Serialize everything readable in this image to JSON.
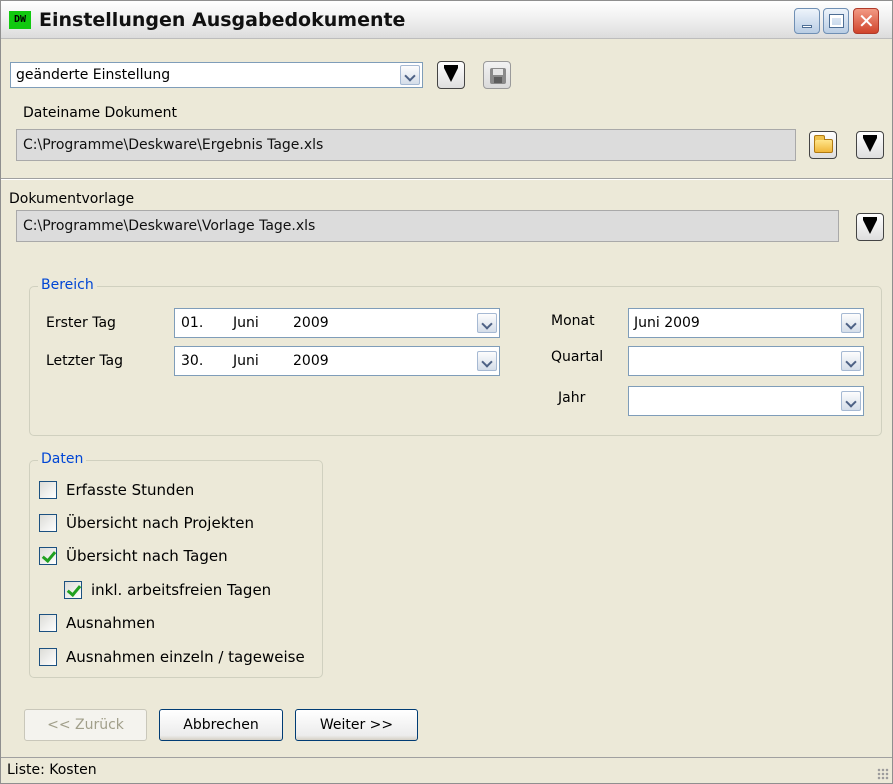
{
  "window": {
    "app_icon_text": "DW",
    "title": "Einstellungen Ausgabedokumente",
    "close_glyph": "✕"
  },
  "preset": {
    "selected": "geänderte Einstellung"
  },
  "document": {
    "filename_label": "Dateiname Dokument",
    "filename_value": "C:\\Programme\\Deskware\\Ergebnis Tage.xls",
    "template_label": "Dokumentvorlage",
    "template_value": "C:\\Programme\\Deskware\\Vorlage Tage.xls"
  },
  "bereich": {
    "title": "Bereich",
    "erster_tag_label": "Erster Tag",
    "erster_tag": {
      "day": "01.",
      "month": "Juni",
      "year": "2009"
    },
    "letzter_tag_label": "Letzter Tag",
    "letzter_tag": {
      "day": "30.",
      "month": "Juni",
      "year": "2009"
    },
    "monat_label": "Monat",
    "monat_value": "Juni 2009",
    "quartal_label": "Quartal",
    "quartal_value": "",
    "jahr_label": "Jahr",
    "jahr_value": ""
  },
  "daten": {
    "title": "Daten",
    "items": [
      {
        "label": "Erfasste Stunden",
        "checked": false
      },
      {
        "label": "Übersicht nach Projekten",
        "checked": false
      },
      {
        "label": "Übersicht nach Tagen",
        "checked": true
      },
      {
        "label": "inkl. arbeitsfreien Tagen",
        "checked": true
      },
      {
        "label": "Ausnahmen",
        "checked": false
      },
      {
        "label": "Ausnahmen einzeln / tageweise",
        "checked": false
      }
    ]
  },
  "buttons": {
    "back": "<< Zurück",
    "cancel": "Abbrechen",
    "next": "Weiter >>"
  },
  "status": {
    "text": "Liste: Kosten"
  },
  "colors": {
    "accent_blue": "#0046d5",
    "check_green": "#21a121",
    "app_icon_green": "#11c90f"
  }
}
